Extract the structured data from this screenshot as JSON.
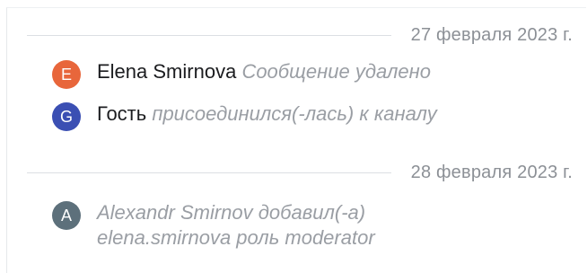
{
  "timeline": {
    "groups": [
      {
        "date": "27 февраля 2023 г.",
        "events": [
          {
            "avatar_letter": "E",
            "avatar_color": "#e8663b",
            "name": "Elena Smirnova",
            "action": "Сообщение удалено"
          },
          {
            "avatar_letter": "G",
            "avatar_color": "#3b4fb3",
            "name": "Гость",
            "action": "присоединился(-лась) к каналу"
          }
        ]
      },
      {
        "date": "28 февраля 2023 г.",
        "events": [
          {
            "avatar_letter": "A",
            "avatar_color": "#5d707b",
            "line1": "Alexandr Smirnov добавил(-а)",
            "line2": "elena.smirnova роль moderator"
          }
        ]
      }
    ]
  }
}
